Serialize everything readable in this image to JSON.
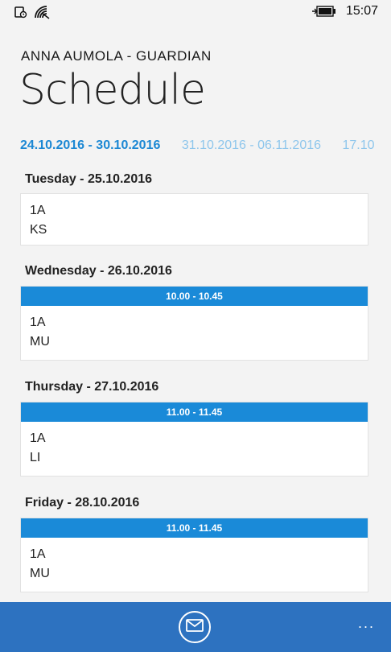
{
  "status": {
    "time": "15:07"
  },
  "header": {
    "account": "ANNA AUMOLA - GUARDIAN",
    "title": "Schedule"
  },
  "weeks": [
    {
      "label": "24.10.2016 - 30.10.2016",
      "active": true
    },
    {
      "label": "31.10.2016 - 06.11.2016",
      "active": false
    },
    {
      "label": "17.10",
      "active": false
    }
  ],
  "days": [
    {
      "title": "Tuesday - 25.10.2016",
      "time": "",
      "group": "1A",
      "subject": "KS"
    },
    {
      "title": "Wednesday - 26.10.2016",
      "time": "10.00  -  10.45",
      "group": "1A",
      "subject": "MU"
    },
    {
      "title": "Thursday - 27.10.2016",
      "time": "11.00  -  11.45",
      "group": "1A",
      "subject": "LI"
    },
    {
      "title": "Friday - 28.10.2016",
      "time": "11.00  -  11.45",
      "group": "1A",
      "subject": "MU"
    }
  ],
  "appbar": {
    "more_label": "..."
  },
  "colors": {
    "accent": "#1a8ad8",
    "appbar": "#2d72c0",
    "inactive_week": "#8ec6ec"
  }
}
